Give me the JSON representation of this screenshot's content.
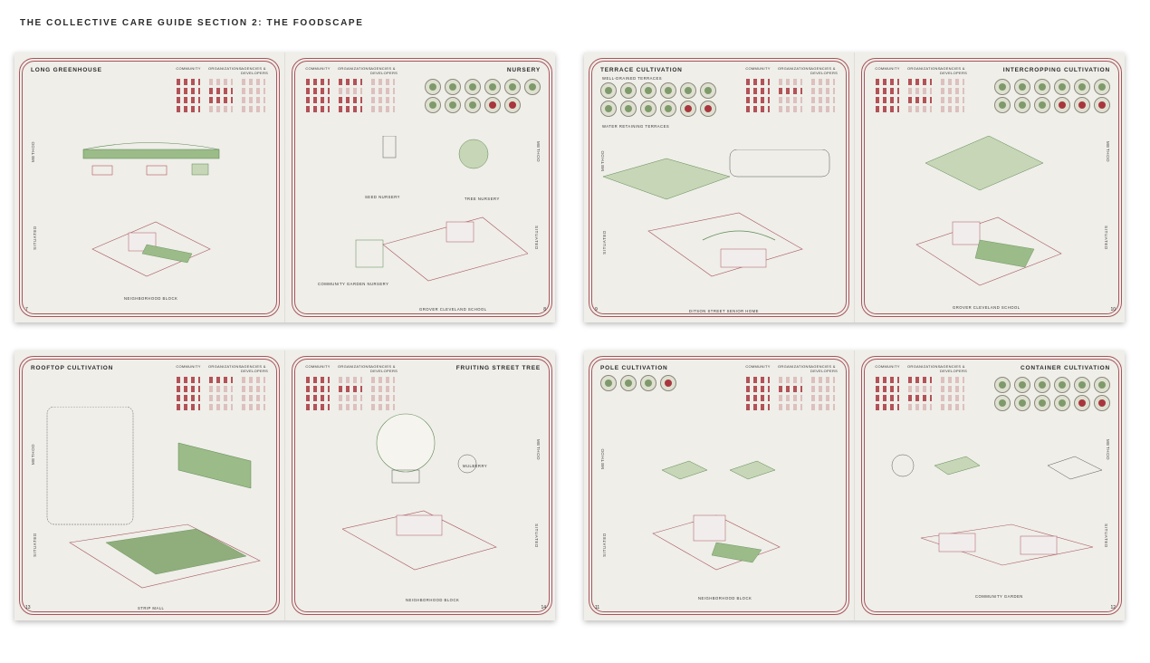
{
  "document_title": "THE COLLECTIVE CARE GUIDE SECTION 2: THE FOODSCAPE",
  "column_headers": [
    "COMMUNITY",
    "ORGANIZATIONS",
    "AGENCIES & DEVELOPERS"
  ],
  "side_labels": {
    "method": "METHOD",
    "situated": "SITUATED"
  },
  "spreads": [
    {
      "left": {
        "title": "LONG GREENHOUSE",
        "page_number": "7",
        "caption": "NEIGHBORHOOD BLOCK"
      },
      "right": {
        "title": "NURSERY",
        "page_number": "8",
        "caption": "GROVER CLEVELAND SCHOOL",
        "sub_captions": [
          "SEED NURSERY",
          "TREE NURSERY",
          "COMMUNITY GARDEN NURSERY"
        ]
      }
    },
    {
      "left": {
        "title": "TERRACE CULTIVATION",
        "page_number": "9",
        "caption": "DITSON STREET SENIOR HOME",
        "sub_captions": [
          "WELL-DRAINED TERRACES",
          "WATER RETAINING TERRACES"
        ]
      },
      "right": {
        "title": "INTERCROPPING CULTIVATION",
        "page_number": "10",
        "caption": "GROVER CLEVELAND SCHOOL"
      }
    },
    {
      "left": {
        "title": "ROOFTOP CULTIVATION",
        "page_number": "13",
        "caption": "STRIP MALL"
      },
      "right": {
        "title": "FRUITING STREET TREE",
        "page_number": "14",
        "caption": "NEIGHBORHOOD BLOCK",
        "sub_captions": [
          "MULBERRY"
        ]
      }
    },
    {
      "left": {
        "title": "POLE CULTIVATION",
        "page_number": "11",
        "caption": "NEIGHBORHOOD BLOCK"
      },
      "right": {
        "title": "CONTAINER CULTIVATION",
        "page_number": "12",
        "caption": "COMMUNITY GARDEN"
      }
    }
  ],
  "colors": {
    "accent_red": "#a8363d",
    "leaf_green": "#5d8a52",
    "paper": "#efeee9"
  }
}
